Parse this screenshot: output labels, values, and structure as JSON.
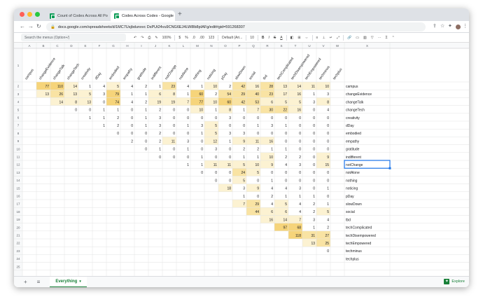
{
  "tabs": [
    {
      "title": "Count of Codes Across All Po",
      "active": false
    },
    {
      "title": "Codes Across Codes - Google",
      "active": true
    }
  ],
  "address": "docs.google.com/spreadsheets/d/1MC7Usjbdunxvc DsPUt24vu9CNG6EJ4LW8lb8pIAFg/edit#gid=591268307",
  "toolbar": {
    "search_placeholder": "Search the menus (Option+/)",
    "zoom": "100%",
    "currency": "$",
    "percent": "%",
    "dec_less": ".0",
    "dec_more": ".00",
    "number_format": "123",
    "font": "Default (Ari...",
    "font_size": "10",
    "bold": "B",
    "italic": "I",
    "strike": "S",
    "text_color": "A"
  },
  "columns": [
    "A",
    "B",
    "C",
    "D",
    "E",
    "F",
    "G",
    "H",
    "I",
    "J",
    "K",
    "L",
    "M",
    "N",
    "O",
    "P",
    "Q",
    "R",
    "S",
    "T",
    "U",
    "V",
    "W",
    "X"
  ],
  "header_labels": [
    "campus",
    "changeEvidence",
    "changeTalk",
    "changeTech",
    "creativity",
    "dDay",
    "embodied",
    "empathy",
    "gratitude",
    "indifferent",
    "notChange",
    "notAlone",
    "nothing",
    "noticing",
    "pDay",
    "slowDown",
    "social",
    "tbd",
    "techComplicated",
    "techDisempowered",
    "techEmpowered",
    "techminus",
    "techplus"
  ],
  "rows": [
    {
      "num": "2",
      "label": "campus",
      "cells": [
        "77",
        "110",
        "14",
        "1",
        "4",
        "5",
        "4",
        "2",
        "1",
        "23",
        "4",
        "1",
        "10",
        "2",
        "42",
        "16",
        "28",
        "13",
        "14",
        "11",
        "10"
      ]
    },
    {
      "num": "3",
      "label": "changeEvidence",
      "cells": [
        "13",
        "26",
        "13",
        "5",
        "3",
        "79",
        "1",
        "1",
        "6",
        "8",
        "1",
        "60",
        "2",
        "54",
        "29",
        "40",
        "23",
        "17",
        "16",
        "1",
        "3"
      ]
    },
    {
      "num": "4",
      "label": "changeTalk",
      "cells": [
        "14",
        "8",
        "13",
        "0",
        "74",
        "4",
        "2",
        "19",
        "19",
        "7",
        "77",
        "10",
        "60",
        "42",
        "53",
        "6",
        "5",
        "5",
        "3",
        "8"
      ]
    },
    {
      "num": "5",
      "label": "changeTech",
      "cells": [
        "0",
        "0",
        "1",
        "1",
        "0",
        "1",
        "2",
        "0",
        "0",
        "10",
        "1",
        "8",
        "1",
        "7",
        "30",
        "22",
        "16",
        "0",
        "4"
      ]
    },
    {
      "num": "6",
      "label": "creativity",
      "cells": [
        "1",
        "1",
        "2",
        "0",
        "1",
        "3",
        "0",
        "0",
        "0",
        "0",
        "3",
        "0",
        "0",
        "0",
        "0",
        "0",
        "0",
        "0"
      ]
    },
    {
      "num": "7",
      "label": "dDay",
      "cells": [
        "1",
        "2",
        "0",
        "1",
        "3",
        "0",
        "1",
        "3",
        "5",
        "0",
        "0",
        "1",
        "3",
        "1",
        "0",
        "0",
        "0"
      ]
    },
    {
      "num": "8",
      "label": "embodied",
      "cells": [
        "0",
        "0",
        "0",
        "2",
        "0",
        "0",
        "1",
        "5",
        "3",
        "3",
        "0",
        "0",
        "0",
        "0",
        "0",
        "0"
      ]
    },
    {
      "num": "9",
      "label": "empathy",
      "cells": [
        "2",
        "0",
        "2",
        "11",
        "3",
        "0",
        "12",
        "1",
        "9",
        "11",
        "16",
        "0",
        "0",
        "0",
        "0"
      ]
    },
    {
      "num": "10",
      "label": "gratitude",
      "cells": [
        "0",
        "1",
        "0",
        "1",
        "0",
        "3",
        "0",
        "2",
        "2",
        "1",
        "1",
        "0",
        "0",
        "0"
      ]
    },
    {
      "num": "11",
      "label": "indifferent",
      "cells": [
        "0",
        "0",
        "0",
        "1",
        "0",
        "0",
        "1",
        "1",
        "10",
        "2",
        "2",
        "0",
        "9"
      ]
    },
    {
      "num": "12",
      "label": "notChange",
      "cells": [
        "1",
        "1",
        "11",
        "11",
        "5",
        "10",
        "9",
        "4",
        "3",
        "0",
        "15"
      ]
    },
    {
      "num": "13",
      "label": "notAlone",
      "cells": [
        "0",
        "0",
        "0",
        "24",
        "5",
        "0",
        "0",
        "0",
        "0",
        "0"
      ]
    },
    {
      "num": "14",
      "label": "nothing",
      "cells": [
        "0",
        "0",
        "5",
        "0",
        "1",
        "0",
        "0",
        "0",
        "0"
      ]
    },
    {
      "num": "15",
      "label": "noticing",
      "cells": [
        "18",
        "3",
        "9",
        "4",
        "4",
        "3",
        "0",
        "1"
      ]
    },
    {
      "num": "16",
      "label": "pDay",
      "cells": [
        "1",
        "0",
        "2",
        "1",
        "1",
        "1",
        "0"
      ]
    },
    {
      "num": "17",
      "label": "slowDown",
      "cells": [
        "7",
        "29",
        "4",
        "5",
        "4",
        "2",
        "1"
      ]
    },
    {
      "num": "18",
      "label": "social",
      "cells": [
        "44",
        "6",
        "6",
        "4",
        "2",
        "5"
      ]
    },
    {
      "num": "19",
      "label": "tbd",
      "cells": [
        "16",
        "14",
        "7",
        "3",
        "4"
      ]
    },
    {
      "num": "20",
      "label": "techComplicated",
      "cells": [
        "97",
        "68",
        "1",
        "2"
      ]
    },
    {
      "num": "21",
      "label": "techDisempowered",
      "cells": [
        "118",
        "31",
        "27"
      ]
    },
    {
      "num": "22",
      "label": "techEmpowered",
      "cells": [
        "13",
        "25"
      ]
    },
    {
      "num": "23",
      "label": "techminus",
      "cells": [
        "0"
      ]
    },
    {
      "num": "24",
      "label": "techplus",
      "cells": []
    },
    {
      "num": "25",
      "label": "",
      "cells": []
    }
  ],
  "selected_cell": "X12",
  "sheet_tab": "Everything",
  "explore_label": "Explore",
  "colors": {
    "heat_high": "#f6d47a",
    "heat_mid": "#f9e3a3",
    "heat_low": "#fcf2d2",
    "selection": "#1a73e8",
    "sheets_green": "#188038"
  }
}
